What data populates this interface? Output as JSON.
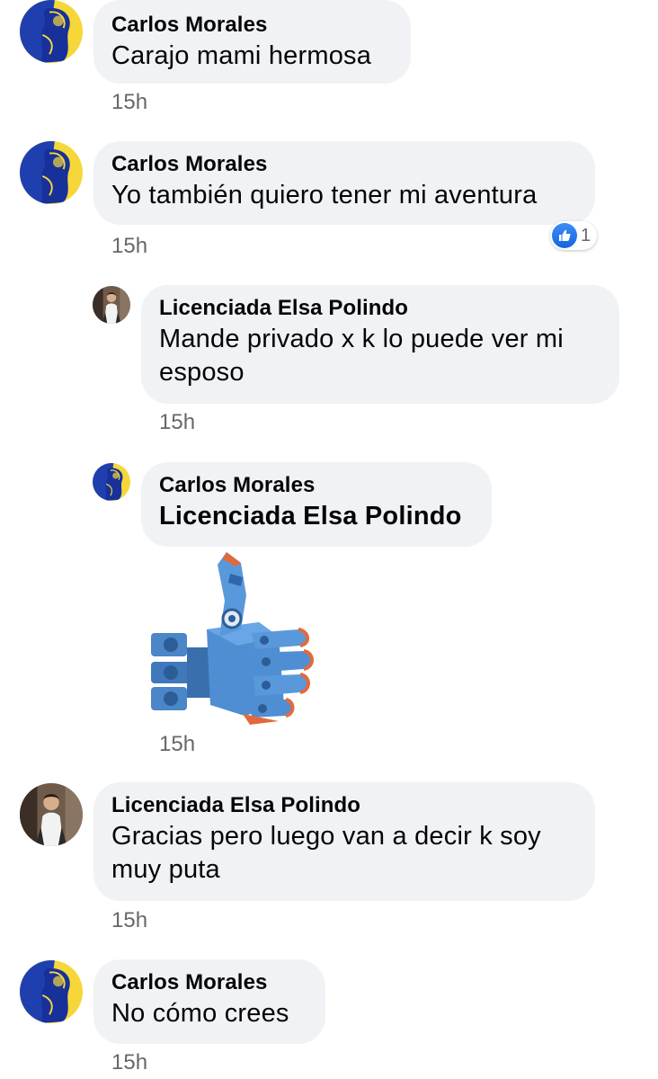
{
  "comments": [
    {
      "author": "Carlos Morales",
      "text": "Carajo mami hermosa",
      "time": "15h"
    },
    {
      "author": "Carlos Morales",
      "text": "Yo también quiero tener mi aventura",
      "time": "15h",
      "reaction": {
        "icon": "like-icon",
        "count": "1"
      }
    },
    {
      "author": "Licenciada Elsa Polindo",
      "text": "Mande privado x k lo puede ver mi esposo",
      "time": "15h"
    },
    {
      "author": "Carlos Morales",
      "text": "Licenciada Elsa Polindo",
      "time": "15h",
      "sticker": "robot-thumbs-up-sticker"
    },
    {
      "author": "Licenciada Elsa Polindo",
      "text": "Gracias pero luego van a decir k soy muy puta",
      "time": "15h"
    },
    {
      "author": "Carlos Morales",
      "text": "No cómo crees",
      "time": "15h"
    }
  ],
  "colors": {
    "bubble": "#f0f2f5",
    "time": "#65676b",
    "like": "#1877f2"
  }
}
